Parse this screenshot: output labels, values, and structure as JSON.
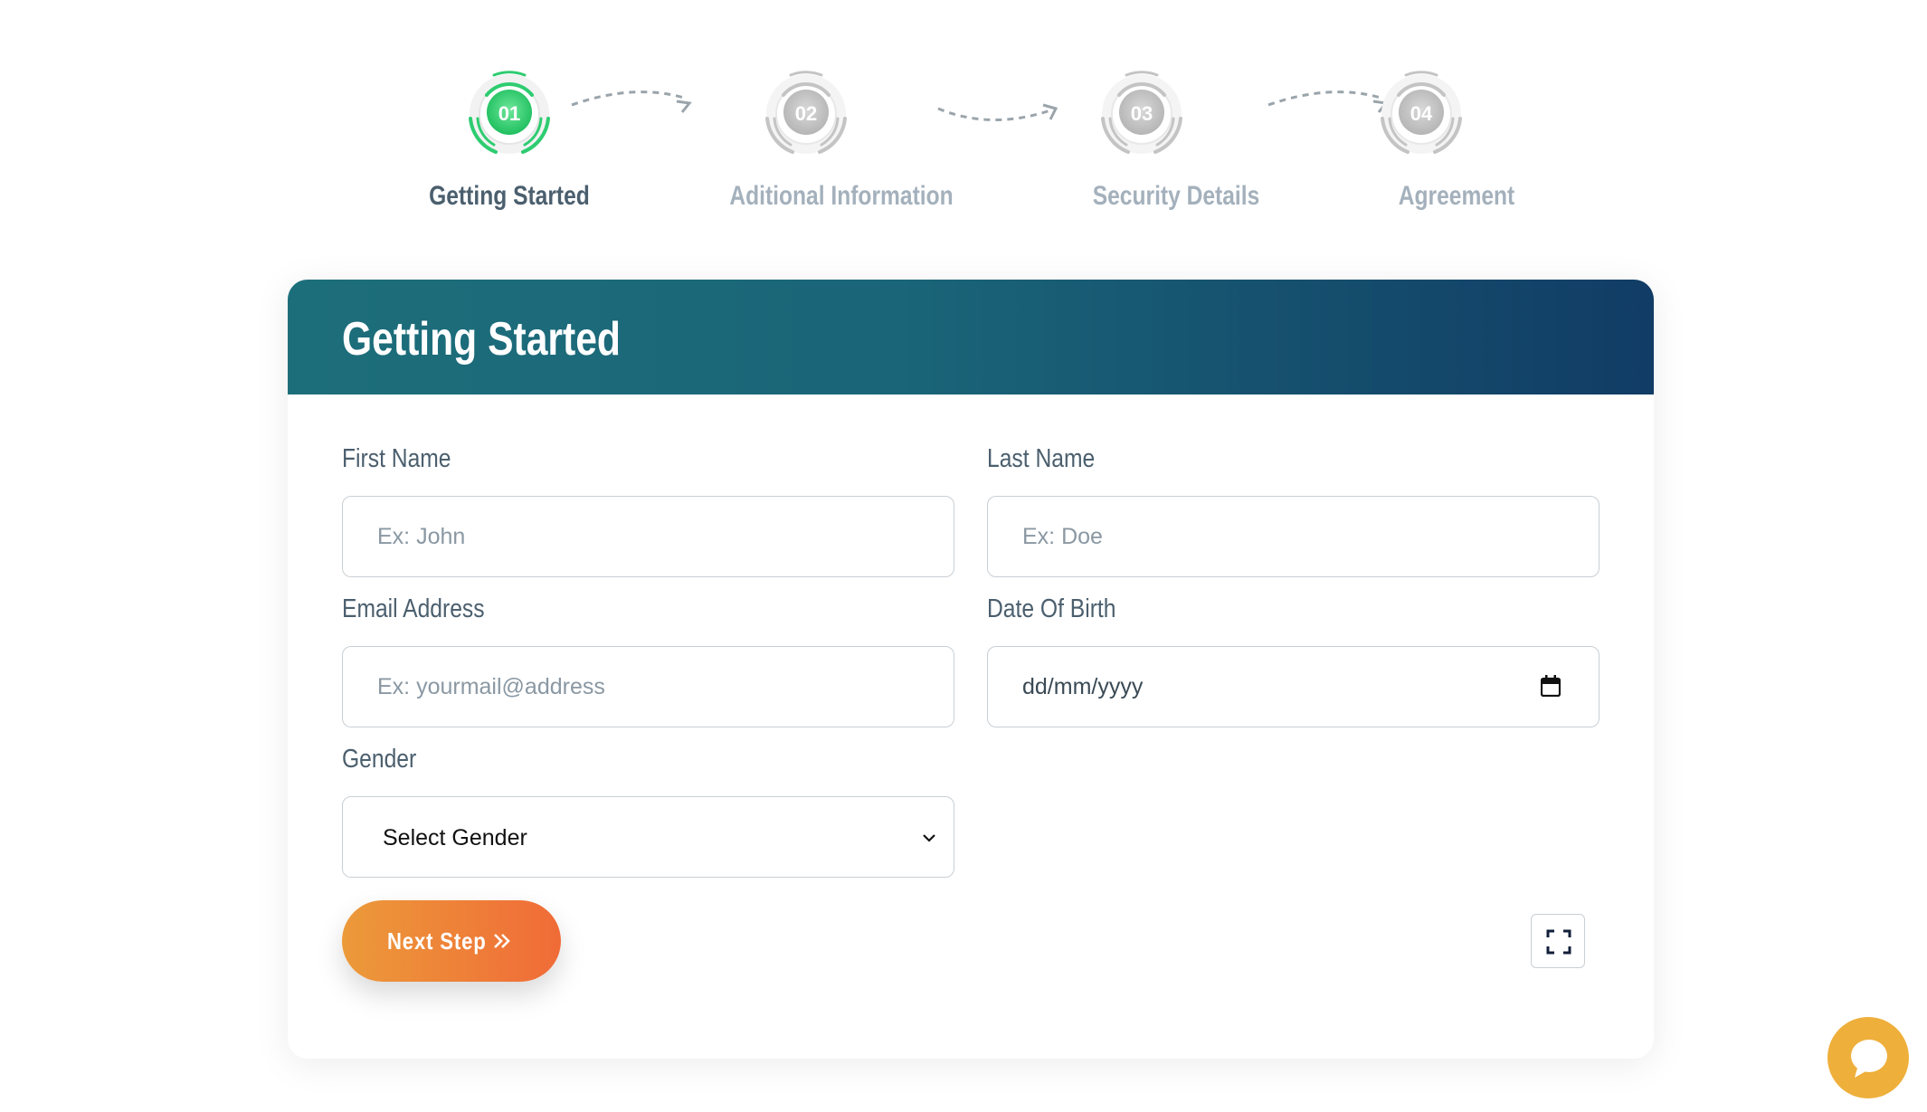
{
  "stepper": {
    "steps": [
      {
        "number": "01",
        "label": "Getting Started",
        "state": "active"
      },
      {
        "number": "02",
        "label": "Aditional Information",
        "state": "inactive"
      },
      {
        "number": "03",
        "label": "Security Details",
        "state": "inactive"
      },
      {
        "number": "04",
        "label": "Agreement",
        "state": "inactive"
      }
    ],
    "colors": {
      "active": "#2ecc71",
      "inactive": "#c9c9c9"
    }
  },
  "form": {
    "title": "Getting Started",
    "first_name": {
      "label": "First Name",
      "placeholder": "Ex: John"
    },
    "last_name": {
      "label": "Last Name",
      "placeholder": "Ex: Doe"
    },
    "email": {
      "label": "Email Address",
      "placeholder": "Ex: yourmail@address"
    },
    "dob": {
      "label": "Date Of Birth",
      "value": "dd/mm/yyyy"
    },
    "gender": {
      "label": "Gender",
      "selected": "Select Gender"
    },
    "next_button": {
      "label": "Next Step"
    }
  },
  "icons": {
    "calendar": "calendar-icon",
    "chevron": "chevron-down-icon",
    "arrow": "double-chevron-right-icon",
    "fullscreen": "fullscreen-icon",
    "chat": "chat-bubble-icon"
  },
  "theme": {
    "header_gradient": [
      "#1d6e7b",
      "#113c65"
    ],
    "button_gradient": [
      "#ec9a3a",
      "#f06b37"
    ],
    "chat_color": "#eeaf3b"
  }
}
